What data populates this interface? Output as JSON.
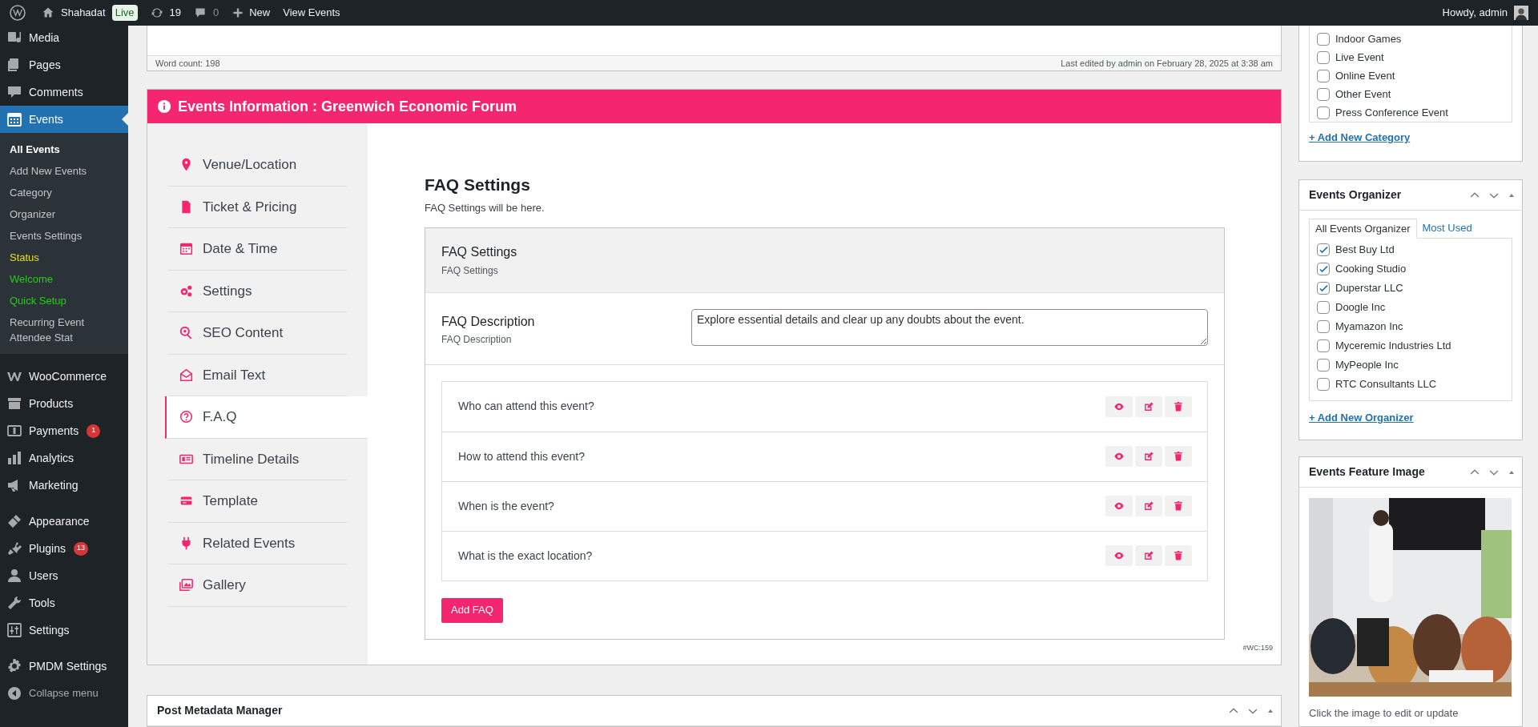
{
  "admin_bar": {
    "site": "Shahadat",
    "live_badge": "Live",
    "updates": "19",
    "comments": "0",
    "new_label": "New",
    "view_label": "View Events",
    "howdy": "Howdy, admin"
  },
  "sidebar": {
    "items": [
      {
        "label": "Media",
        "selected": false,
        "separator_before": false
      },
      {
        "label": "Pages",
        "selected": false,
        "separator_before": false
      },
      {
        "label": "Comments",
        "selected": false,
        "separator_before": false
      },
      {
        "label": "Events",
        "selected": true,
        "separator_before": false,
        "children": [
          {
            "label": "All Events",
            "selected": true
          },
          {
            "label": "Add New Events",
            "selected": false
          },
          {
            "label": "Category",
            "selected": false
          },
          {
            "label": "Organizer",
            "selected": false
          },
          {
            "label": "Events Settings",
            "selected": false
          },
          {
            "label": "Status",
            "selected": false,
            "color": "#f0db1a"
          },
          {
            "label": "Welcome",
            "selected": false,
            "color": "#1fd10f"
          },
          {
            "label": "Quick Setup",
            "selected": false,
            "color": "#1fd10f"
          },
          {
            "label": "Recurring Event Attendee Stat",
            "selected": false
          }
        ]
      },
      {
        "label": "WooCommerce",
        "selected": false,
        "separator_before": true
      },
      {
        "label": "Products",
        "selected": false,
        "separator_before": false
      },
      {
        "label": "Payments",
        "selected": false,
        "separator_before": false,
        "badge": "1"
      },
      {
        "label": "Analytics",
        "selected": false,
        "separator_before": false
      },
      {
        "label": "Marketing",
        "selected": false,
        "separator_before": false
      },
      {
        "label": "Appearance",
        "selected": false,
        "separator_before": true
      },
      {
        "label": "Plugins",
        "selected": false,
        "separator_before": false,
        "badge": "13"
      },
      {
        "label": "Users",
        "selected": false,
        "separator_before": false
      },
      {
        "label": "Tools",
        "selected": false,
        "separator_before": false
      },
      {
        "label": "Settings",
        "selected": false,
        "separator_before": false
      },
      {
        "label": "PMDM Settings",
        "selected": false,
        "separator_before": true
      }
    ],
    "collapse": "Collapse menu"
  },
  "editor": {
    "word_count": "Word count: 198",
    "last_edited": "Last edited by admin on February 28, 2025 at 3:38 am"
  },
  "events_panel": {
    "title": "Events Information : Greenwich Economic Forum",
    "tabs": [
      {
        "label": "Venue/Location",
        "selected": false
      },
      {
        "label": "Ticket & Pricing",
        "selected": false
      },
      {
        "label": "Date & Time",
        "selected": false
      },
      {
        "label": "Settings",
        "selected": false
      },
      {
        "label": "SEO Content",
        "selected": false
      },
      {
        "label": "Email Text",
        "selected": false
      },
      {
        "label": "F.A.Q",
        "selected": true
      },
      {
        "label": "Timeline Details",
        "selected": false
      },
      {
        "label": "Template",
        "selected": false
      },
      {
        "label": "Related Events",
        "selected": false
      },
      {
        "label": "Gallery",
        "selected": false
      }
    ],
    "faq": {
      "heading": "FAQ Settings",
      "subheading": "FAQ Settings will be here.",
      "settings_title": "FAQ Settings",
      "settings_subtitle": "FAQ Settings",
      "description_label": "FAQ Description",
      "description_sublabel": "FAQ Description",
      "description_value": "Explore essential details and clear up any doubts about the event.",
      "items": [
        "Who can attend this event?",
        "How to attend this event?",
        "When is the event?",
        "What is the exact location?"
      ],
      "add_button": "Add FAQ"
    },
    "footer_code": "#WC:159"
  },
  "post_metadata": {
    "title": "Post Metadata Manager"
  },
  "categories": {
    "items": [
      {
        "label": "Indoor Games",
        "checked": false
      },
      {
        "label": "Live Event",
        "checked": false
      },
      {
        "label": "Online Event",
        "checked": false
      },
      {
        "label": "Other Event",
        "checked": false
      },
      {
        "label": "Press Conference Event",
        "checked": false
      }
    ],
    "add_link": "+ Add New Category"
  },
  "organizer": {
    "title": "Events Organizer",
    "tabs": [
      {
        "label": "All Events Organizer",
        "selected": true
      },
      {
        "label": "Most Used",
        "selected": false
      }
    ],
    "items": [
      {
        "label": "Best Buy Ltd",
        "checked": true
      },
      {
        "label": "Cooking Studio",
        "checked": true
      },
      {
        "label": "Duperstar LLC",
        "checked": true
      },
      {
        "label": "Doogle Inc",
        "checked": false
      },
      {
        "label": "Myamazon Inc",
        "checked": false
      },
      {
        "label": "Myceremic Industries Ltd",
        "checked": false
      },
      {
        "label": "MyPeople Inc",
        "checked": false
      },
      {
        "label": "RTC Consultants LLC",
        "checked": false
      }
    ],
    "add_link": "+ Add New Organizer"
  },
  "feature_image": {
    "title": "Events Feature Image",
    "caption": "Click the image to edit or update"
  }
}
